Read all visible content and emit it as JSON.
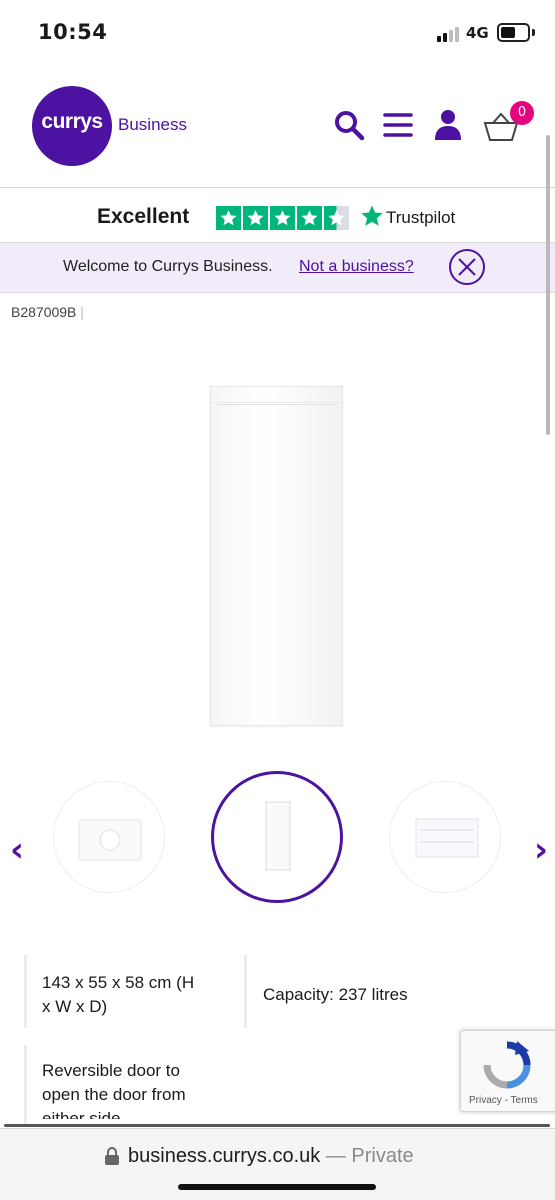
{
  "status_bar": {
    "time": "10:54",
    "network": "4G"
  },
  "header": {
    "logo_word": "currys",
    "logo_suffix": "Business",
    "cart_count": "0",
    "icons": [
      "search-icon",
      "menu-icon",
      "account-icon",
      "basket-icon"
    ]
  },
  "trustpilot": {
    "rating_label": "Excellent",
    "brand": "Trustpilot",
    "stars": 4.5
  },
  "welcome": {
    "text": "Welcome to Currys Business.",
    "link": "Not a business?"
  },
  "product": {
    "sku": "B287009B",
    "sku_sep": "|",
    "specs": {
      "dimensions_line1": "143 x 55 x 58 cm (H",
      "dimensions_line2": "x W x D)",
      "capacity": "Capacity: 237 litres",
      "door_line1": "Reversible door to",
      "door_line2": "open the door from",
      "door_line3": "either side"
    }
  },
  "carousel": {
    "prev": "‹",
    "next": "›"
  },
  "recaptcha": {
    "privacy": "Privacy",
    "separator": "-",
    "terms": "Terms"
  },
  "browser": {
    "url": "business.currys.co.uk",
    "mode": "— Private"
  },
  "colors": {
    "brand_purple": "#4c12a1",
    "trustpilot_green": "#00b67a",
    "badge_pink": "#e4057e",
    "banner_bg": "#f2ecfa"
  }
}
